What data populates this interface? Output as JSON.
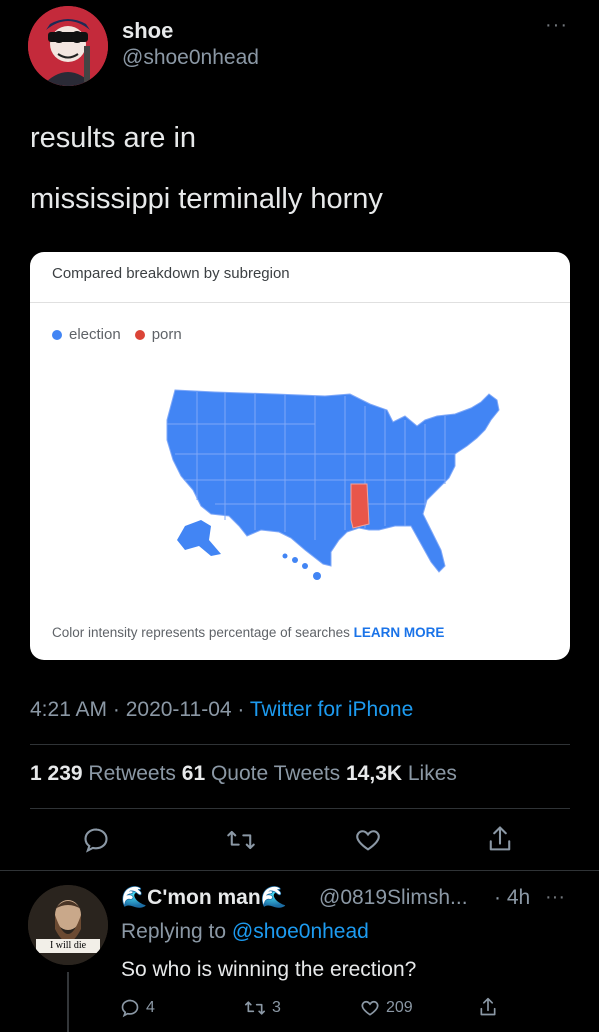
{
  "tweet": {
    "author_name": "shoe",
    "author_handle": "@shoe0nhead",
    "more": "···",
    "lines": [
      "results are in",
      "mississippi terminally horny"
    ],
    "timestamp": "4:21 AM · 2020-11-04 · ",
    "source": "Twitter for iPhone",
    "stats": {
      "retweets_count": "1 239",
      "retweets_label": " Retweets ",
      "quotes_count": "61",
      "quotes_label": " Quote Tweets ",
      "likes_count": "14,3K",
      "likes_label": " Likes"
    }
  },
  "card": {
    "title": "Compared breakdown by subregion",
    "legend": [
      {
        "label": "election",
        "color": "#4285f4"
      },
      {
        "label": "porn",
        "color": "#db4437"
      }
    ],
    "footnote": "Color intensity represents percentage of searches ",
    "learn_more": "LEARN MORE",
    "map_colors": {
      "election": "#4285f4",
      "porn": "#e8564a",
      "border": "#7fa8f8"
    }
  },
  "reply": {
    "name": "C'mon man",
    "name_emoji": "🌊",
    "handle": "@0819Slimsh...",
    "time": "· 4h",
    "more": "···",
    "replying_prefix": "Replying to ",
    "replying_to": "@shoe0nhead",
    "text": "So who is winning the erection?",
    "avatar_caption": "I will die",
    "stats": {
      "replies": "4",
      "retweets": "3",
      "likes": "209"
    }
  }
}
